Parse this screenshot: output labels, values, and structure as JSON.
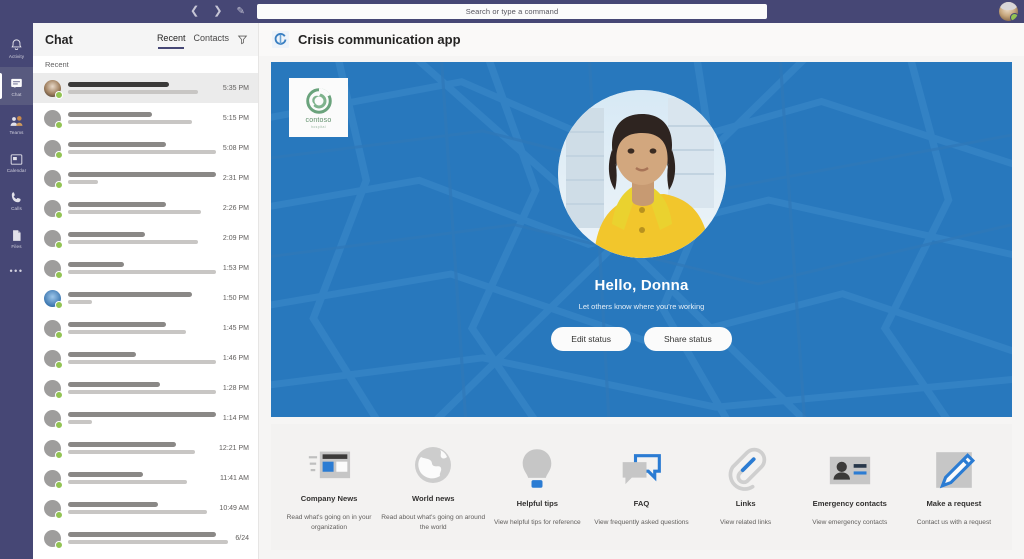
{
  "titlebar": {
    "back_icon": "chevron-left-icon",
    "forward_icon": "chevron-right-icon",
    "compose_icon": "compose-icon",
    "search_placeholder": "Search or type a command",
    "avatar_presence": "available"
  },
  "rail": {
    "items": [
      {
        "label": "Activity",
        "icon": "bell-icon",
        "active": false
      },
      {
        "label": "Chat",
        "icon": "chat-icon",
        "active": true
      },
      {
        "label": "Teams",
        "icon": "teams-icon",
        "active": false
      },
      {
        "label": "Calendar",
        "icon": "calendar-icon",
        "active": false
      },
      {
        "label": "Calls",
        "icon": "phone-icon",
        "active": false
      },
      {
        "label": "Files",
        "icon": "files-icon",
        "active": false
      }
    ],
    "more_label": "•••"
  },
  "chat_pane": {
    "title": "Chat",
    "tabs": [
      {
        "label": "Recent",
        "active": true
      },
      {
        "label": "Contacts",
        "active": false
      }
    ],
    "filter_icon": "filter-funnel-icon",
    "section_label": "Recent",
    "rows": [
      {
        "time": "5:35 PM",
        "selected": true,
        "avatar": "photo",
        "l1": 68,
        "l2": 88
      },
      {
        "time": "5:15 PM",
        "selected": false,
        "avatar": "gray",
        "l1": 57,
        "l2": 84
      },
      {
        "time": "5:08 PM",
        "selected": false,
        "avatar": "gray",
        "l1": 66,
        "l2": 100
      },
      {
        "time": "2:31 PM",
        "selected": false,
        "avatar": "gray",
        "l1": 100,
        "l2": 20
      },
      {
        "time": "2:26 PM",
        "selected": false,
        "avatar": "gray",
        "l1": 66,
        "l2": 90
      },
      {
        "time": "2:09 PM",
        "selected": false,
        "avatar": "gray",
        "l1": 52,
        "l2": 88
      },
      {
        "time": "1:53 PM",
        "selected": false,
        "avatar": "gray",
        "l1": 38,
        "l2": 100
      },
      {
        "time": "1:50 PM",
        "selected": false,
        "avatar": "blue",
        "l1": 84,
        "l2": 16
      },
      {
        "time": "1:45 PM",
        "selected": false,
        "avatar": "gray",
        "l1": 66,
        "l2": 80
      },
      {
        "time": "1:46 PM",
        "selected": false,
        "avatar": "gray",
        "l1": 46,
        "l2": 100
      },
      {
        "time": "1:28 PM",
        "selected": false,
        "avatar": "gray",
        "l1": 62,
        "l2": 100
      },
      {
        "time": "1:14 PM",
        "selected": false,
        "avatar": "gray",
        "l1": 100,
        "l2": 16
      },
      {
        "time": "12:21 PM",
        "selected": false,
        "avatar": "gray",
        "l1": 75,
        "l2": 88
      },
      {
        "time": "11:41 AM",
        "selected": false,
        "avatar": "gray",
        "l1": 52,
        "l2": 82
      },
      {
        "time": "10:49 AM",
        "selected": false,
        "avatar": "gray",
        "l1": 62,
        "l2": 96
      },
      {
        "time": "6/24",
        "selected": false,
        "avatar": "gray",
        "l1": 92,
        "l2": 100
      }
    ]
  },
  "app_header": {
    "icon": "crisis-app-icon",
    "title": "Crisis communication app"
  },
  "hero": {
    "logo": {
      "icon": "contoso-swirl-icon",
      "name": "contoso",
      "sub": "hospital"
    },
    "portrait_alt": "user-portrait",
    "greeting": "Hello, Donna",
    "subtitle": "Let others know where you're working",
    "buttons": [
      {
        "label": "Edit status",
        "name": "edit-status-button"
      },
      {
        "label": "Share status",
        "name": "share-status-button"
      }
    ],
    "background_color": "#2878bd"
  },
  "tiles": [
    {
      "icon": "newspaper-icon",
      "name": "Company News",
      "desc": "Read what's going on in your organization"
    },
    {
      "icon": "globe-icon",
      "name": "World news",
      "desc": "Read about what's going on around the world"
    },
    {
      "icon": "lightbulb-icon",
      "name": "Helpful tips",
      "desc": "View helpful tips for reference"
    },
    {
      "icon": "speech-bubbles-icon",
      "name": "FAQ",
      "desc": "View frequently asked questions"
    },
    {
      "icon": "paperclip-icon",
      "name": "Links",
      "desc": "View related links"
    },
    {
      "icon": "contact-card-icon",
      "name": "Emergency contacts",
      "desc": "View emergency contacts"
    },
    {
      "icon": "pencil-note-icon",
      "name": "Make a request",
      "desc": "Contact us with a request"
    }
  ]
}
